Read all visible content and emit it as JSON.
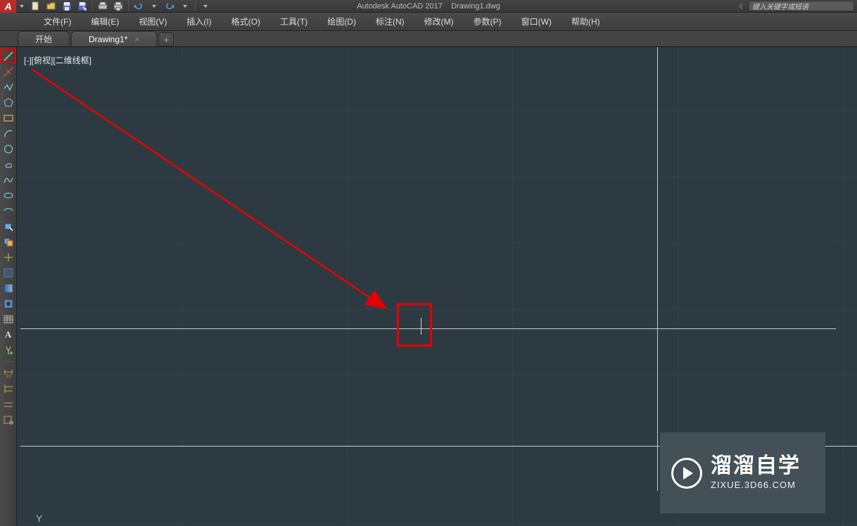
{
  "titlebar": {
    "app_name": "Autodesk AutoCAD 2017",
    "file_name": "Drawing1.dwg",
    "search_placeholder": "键入关键字或短语"
  },
  "menus": {
    "items": [
      "文件(F)",
      "编辑(E)",
      "视图(V)",
      "插入(I)",
      "格式(O)",
      "工具(T)",
      "绘图(D)",
      "标注(N)",
      "修改(M)",
      "参数(P)",
      "窗口(W)",
      "帮助(H)"
    ]
  },
  "tabs": {
    "home": "开始",
    "drawing": "Drawing1*"
  },
  "canvas": {
    "view_label": "[-][俯视][二维线框]",
    "y_axis": "Y"
  },
  "watermark": {
    "line1": "溜溜自学",
    "line2": "ZIXUE.3D66.COM"
  },
  "tools": {
    "names": [
      "line",
      "construction-line",
      "polyline",
      "polygon",
      "rectangle",
      "arc",
      "circle",
      "revision-cloud",
      "spline",
      "ellipse",
      "ellipse-arc",
      "insert-block",
      "make-block",
      "point",
      "hatch",
      "gradient",
      "region",
      "table",
      "text",
      "add-selected"
    ],
    "names2": [
      "dim-linear",
      "dim-multiline",
      "dim-continue",
      "dimstyle"
    ]
  }
}
